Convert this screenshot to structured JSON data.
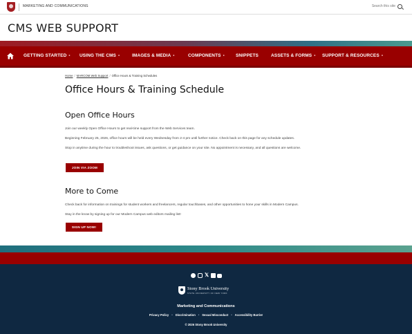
{
  "utility": {
    "department": "MARKETING AND COMMUNICATIONS",
    "search_label": "Search this site"
  },
  "site": {
    "title": "CMS WEB SUPPORT"
  },
  "nav": {
    "items": [
      {
        "label": "GETTING STARTED",
        "has_dropdown": true
      },
      {
        "label": "USING THE CMS",
        "has_dropdown": true
      },
      {
        "label": "IMAGES & MEDIA",
        "has_dropdown": true
      },
      {
        "label": "COMPONENTS",
        "has_dropdown": true
      },
      {
        "label": "SNIPPETS",
        "has_dropdown": false
      },
      {
        "label": "ASSETS & FORMS",
        "has_dropdown": true
      },
      {
        "label": "SUPPORT & RESOURCES",
        "has_dropdown": true
      }
    ],
    "dropdown_marker": "•"
  },
  "breadcrumb": {
    "items": [
      "Home",
      "MARCOM Web Support",
      "Office Hours & Training Schedules"
    ],
    "separator": "/"
  },
  "page": {
    "title": "Office Hours & Training Schedule",
    "sections": [
      {
        "heading": "Open Office Hours",
        "paragraphs": [
          "Join our weekly Open Office Hours to get real-time support from the Web Services team.",
          "Beginning February 25, 2026, office hours will be held every Wednesday from 2-4 pm until further notice. Check back on this page for any schedule updates.",
          "Stop in anytime during the hour to troubleshoot issues, ask questions, or get guidance on your site. No appointment is necessary, and all questions are welcome."
        ],
        "button": "JOIN VIA ZOOM"
      },
      {
        "heading": "More to Come",
        "paragraphs": [
          "Check back for information on trainings for student workers and freelancers, regular touchbases, and other opportunities to hone your skills in Modern Campus.",
          "Stay in the know by signing up for our Modern Campus web editors mailing list!"
        ],
        "button": "SIGN UP NOW!"
      }
    ]
  },
  "footer": {
    "social_icons": [
      "facebook-icon",
      "instagram-icon",
      "x-icon",
      "linkedin-icon",
      "youtube-icon"
    ],
    "logo_name": "Stony Brook University",
    "logo_subtitle": "State University of New York",
    "department": "Marketing and Communications",
    "links": [
      "Privacy Policy",
      "Discrimination",
      "Sexual Misconduct",
      "Accessibility Barrier"
    ],
    "link_separator": "•",
    "copyright": "© 2026 Stony Brook University"
  },
  "colors": {
    "brand_red": "#990000",
    "footer_navy": "#0f2841",
    "accent_teal": "#2e8a8a"
  }
}
